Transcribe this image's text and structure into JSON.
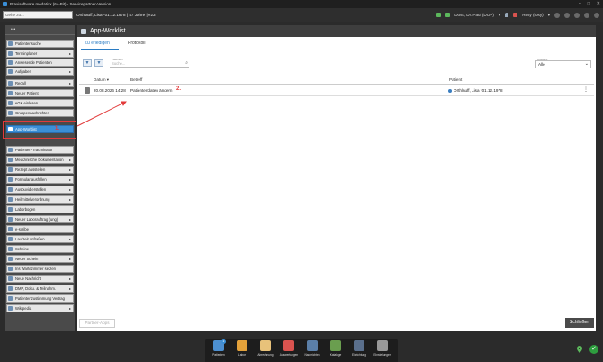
{
  "window": {
    "title": "Praxisoftware medatixx (64-Bit) - Servicepartner-Version",
    "controls": [
      "–",
      "□",
      "✕"
    ]
  },
  "header": {
    "search_placeholder": "Gehe zu...",
    "patient": "Orthlauff, Lisa *01.12.1978 | 47 Jahre | #23",
    "doctor": "Doss, Dr. Paul (DOP)",
    "user": "Rosy (rosy)"
  },
  "sidebar": {
    "top_label": "•••",
    "items": [
      {
        "label": "Patientensuche",
        "arrow": false
      },
      {
        "label": "Terminplaner",
        "arrow": true
      },
      {
        "label": "Anwesende Patienten",
        "arrow": false
      },
      {
        "label": "Aufgaben",
        "arrow": true
      },
      {
        "label": "Recall",
        "arrow": true
      },
      {
        "label": "Neuer Patient",
        "arrow": false
      },
      {
        "label": "eGK einlesen",
        "arrow": false
      },
      {
        "label": "Gruppennachrichten",
        "arrow": false
      },
      {
        "label": "App-Worklist",
        "arrow": false,
        "active": true
      },
      {
        "label": "Patienten-Trauminator",
        "arrow": false
      },
      {
        "label": "Medizinische Dokumentation",
        "arrow": true
      },
      {
        "label": "Rezept ausstellen",
        "arrow": true
      },
      {
        "label": "Formular ausfüllen",
        "arrow": true
      },
      {
        "label": "Ausbuvid erstellen",
        "arrow": true
      },
      {
        "label": "Heilmittelverordnung",
        "arrow": true
      },
      {
        "label": "Laborbogen",
        "arrow": false
      },
      {
        "label": "Neuer Laborauftrag (ung)",
        "arrow": true
      },
      {
        "label": "e-scribe",
        "arrow": false
      },
      {
        "label": "Laufzeit anfraßen",
        "arrow": true
      },
      {
        "label": "Scheine",
        "arrow": false
      },
      {
        "label": "Neuer Schein",
        "arrow": true
      },
      {
        "label": "Ins Wartezimmer setzen",
        "arrow": false
      },
      {
        "label": "Neue Nachricht",
        "arrow": true
      },
      {
        "label": "DMP, Doku. & Teilnahm.",
        "arrow": true
      },
      {
        "label": "Patientenzustimmung Vertrag",
        "arrow": false
      },
      {
        "label": "Wikipedia",
        "arrow": true
      }
    ]
  },
  "annotations": {
    "step1": "1.",
    "step2": "2."
  },
  "main": {
    "title": "App-Worklist",
    "tabs": [
      "Zu erledigen",
      "Protokoll"
    ],
    "filter_icons": [
      "filter-icon",
      "filter-clear-icon"
    ],
    "search_label": "Patienten",
    "search_placeholder": "Suche...",
    "auswahl_label": "Auswahl",
    "auswahl_value": "Alle",
    "columns": {
      "datum": "Datum ▾",
      "betreff": "Betreff",
      "patient": "Patient"
    },
    "rows": [
      {
        "datum": "20.08.2026 14:28",
        "betreff": "Patientendaten ändern",
        "patient": "Orthlauff, Lisa *01.12.1978"
      }
    ],
    "partner_button": "Partner-Apps",
    "close_button": "Schließen"
  },
  "dock": {
    "items": [
      {
        "label": "Patienten",
        "icon": "patients-icon",
        "color": "#4c8fd0",
        "badge": "2"
      },
      {
        "label": "Labor",
        "icon": "lab-icon",
        "color": "#e3a13a"
      },
      {
        "label": "Abrechnung",
        "icon": "billing-icon",
        "color": "#e8c27a"
      },
      {
        "label": "Auswertungen",
        "icon": "statistics-icon",
        "color": "#d9534f"
      },
      {
        "label": "Nachrichten",
        "icon": "messages-icon",
        "color": "#5b7fa8"
      },
      {
        "label": "Kataloge",
        "icon": "catalog-icon",
        "color": "#6a9e4f"
      },
      {
        "label": "Einrichtung",
        "icon": "setup-icon",
        "color": "#5a6f8c"
      },
      {
        "label": "Einstellungen",
        "icon": "settings-icon",
        "color": "#999999"
      }
    ]
  },
  "status": {
    "ok_symbol": "✓"
  }
}
